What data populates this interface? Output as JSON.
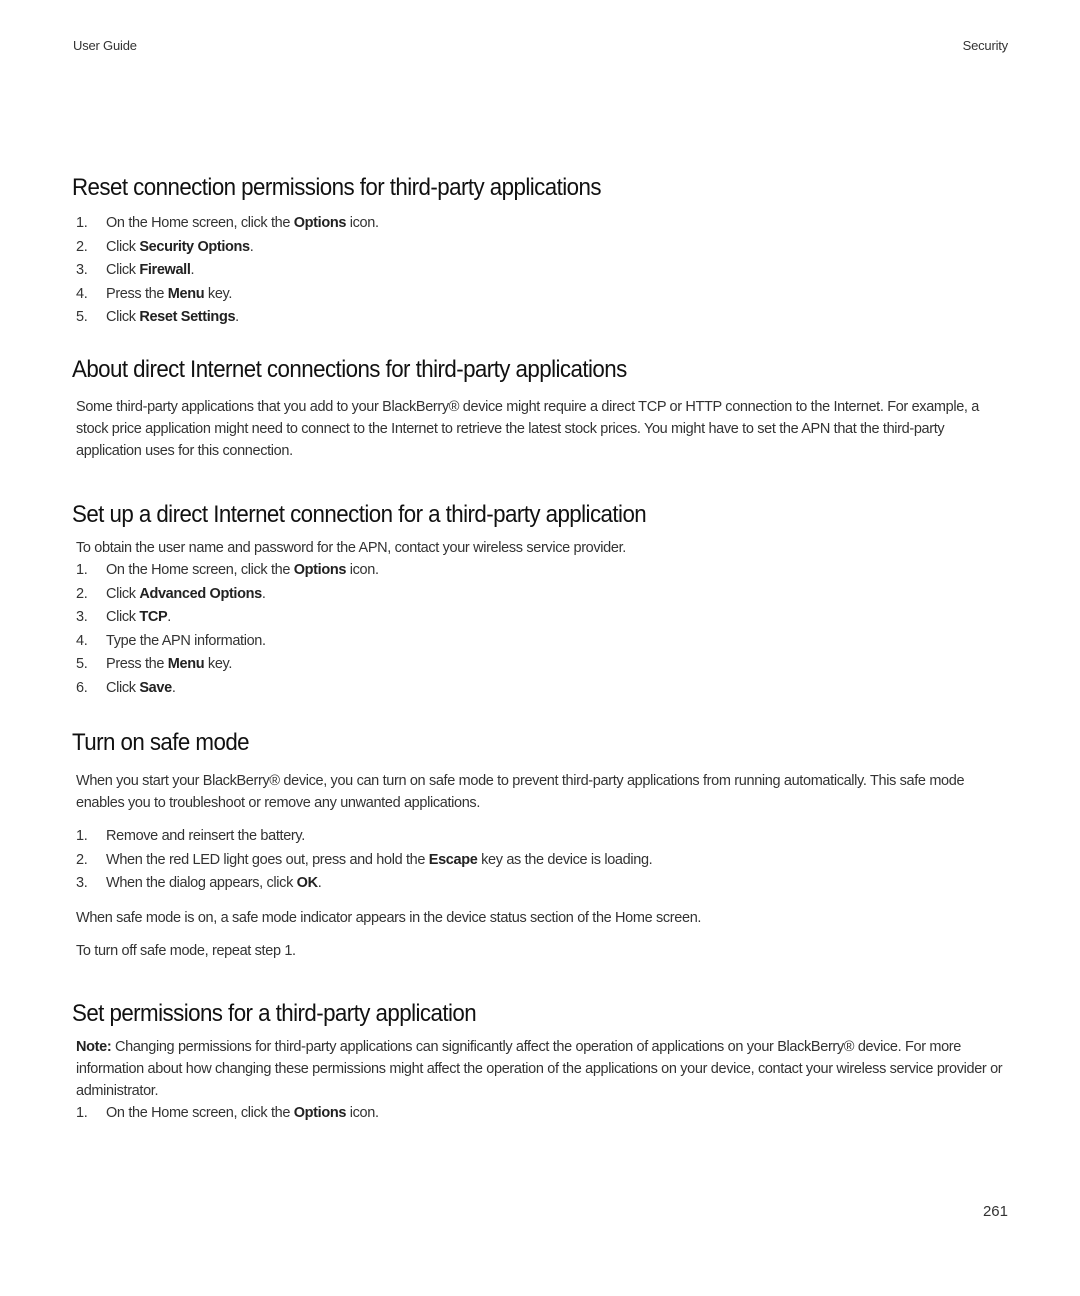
{
  "header": {
    "left": "User Guide",
    "right": "Security"
  },
  "sections": [
    {
      "title": "Reset connection permissions for third-party applications",
      "steps": [
        {
          "n": "1.",
          "pre": "On the Home screen, click the ",
          "bold": "Options",
          "post": " icon."
        },
        {
          "n": "2.",
          "pre": "Click ",
          "bold": "Security Options",
          "post": "."
        },
        {
          "n": "3.",
          "pre": "Click ",
          "bold": "Firewall",
          "post": "."
        },
        {
          "n": "4.",
          "pre": "Press the ",
          "bold": "Menu",
          "post": " key."
        },
        {
          "n": "5.",
          "pre": "Click ",
          "bold": "Reset Settings",
          "post": "."
        }
      ]
    },
    {
      "title": "About direct Internet connections for third-party applications",
      "body": "Some third-party applications that you add to your BlackBerry® device might require a direct TCP or HTTP connection to the Internet. For example, a stock price application might need to connect to the Internet to retrieve the latest stock prices. You might have to set the APN that the third-party application uses for this connection."
    },
    {
      "title": "Set up a direct Internet connection for a third-party application",
      "intro": "To obtain the user name and password for the APN, contact your wireless service provider.",
      "steps": [
        {
          "n": "1.",
          "pre": "On the Home screen, click the ",
          "bold": "Options",
          "post": " icon."
        },
        {
          "n": "2.",
          "pre": "Click ",
          "bold": "Advanced Options",
          "post": "."
        },
        {
          "n": "3.",
          "pre": "Click ",
          "bold": "TCP",
          "post": "."
        },
        {
          "n": "4.",
          "pre": "Type the APN information.",
          "bold": "",
          "post": ""
        },
        {
          "n": "5.",
          "pre": "Press the ",
          "bold": "Menu",
          "post": " key."
        },
        {
          "n": "6.",
          "pre": "Click ",
          "bold": "Save",
          "post": "."
        }
      ]
    },
    {
      "title": "Turn on safe mode",
      "intro": "When you start your BlackBerry® device, you can turn on safe mode to prevent third-party applications from running automatically. This safe mode enables you to troubleshoot or remove any unwanted applications.",
      "steps": [
        {
          "n": "1.",
          "pre": "Remove and reinsert the battery.",
          "bold": "",
          "post": ""
        },
        {
          "n": "2.",
          "pre": "When the red LED light goes out, press and hold the ",
          "bold": "Escape",
          "post": " key as the device is loading."
        },
        {
          "n": "3.",
          "pre": "When the dialog appears, click ",
          "bold": "OK",
          "post": "."
        }
      ],
      "after1": "When safe mode is on, a safe mode indicator appears in the device status section of the Home screen.",
      "after2": "To turn off safe mode, repeat step 1."
    },
    {
      "title": "Set permissions for a third-party application",
      "note_label": "Note:",
      "note_text": "  Changing permissions for third-party applications can significantly affect the operation of applications on your BlackBerry® device. For more information about how changing these permissions might affect the operation of the applications on your device, contact your wireless service provider or administrator.",
      "steps": [
        {
          "n": "1.",
          "pre": "On the Home screen, click the ",
          "bold": "Options",
          "post": " icon."
        }
      ]
    }
  ],
  "page_number": "261"
}
